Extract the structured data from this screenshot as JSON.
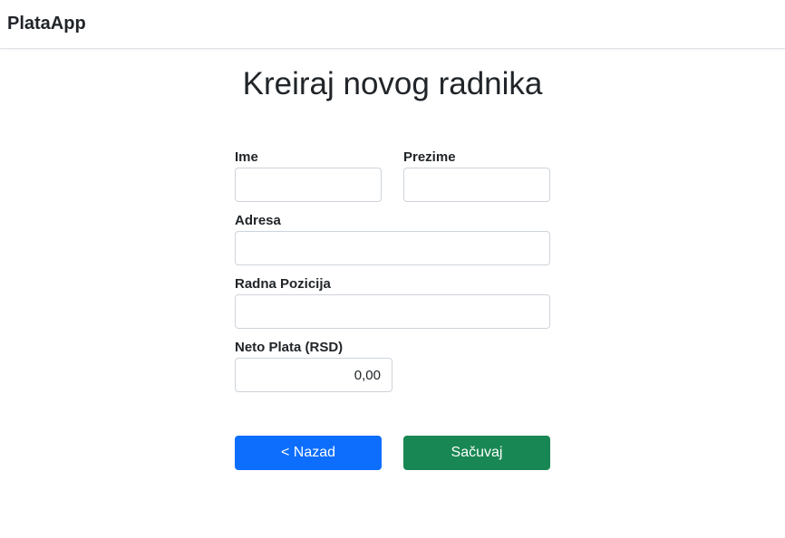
{
  "navbar": {
    "brand": "PlataApp"
  },
  "page": {
    "title": "Kreiraj novog radnika"
  },
  "form": {
    "ime": {
      "label": "Ime",
      "value": ""
    },
    "prezime": {
      "label": "Prezime",
      "value": ""
    },
    "adresa": {
      "label": "Adresa",
      "value": ""
    },
    "pozicija": {
      "label": "Radna Pozicija",
      "value": ""
    },
    "plata": {
      "label": "Neto Plata (RSD)",
      "value": "0,00"
    }
  },
  "buttons": {
    "back": "< Nazad",
    "save": "Sačuvaj"
  },
  "colors": {
    "primary": "#0d6efd",
    "success": "#198754"
  }
}
